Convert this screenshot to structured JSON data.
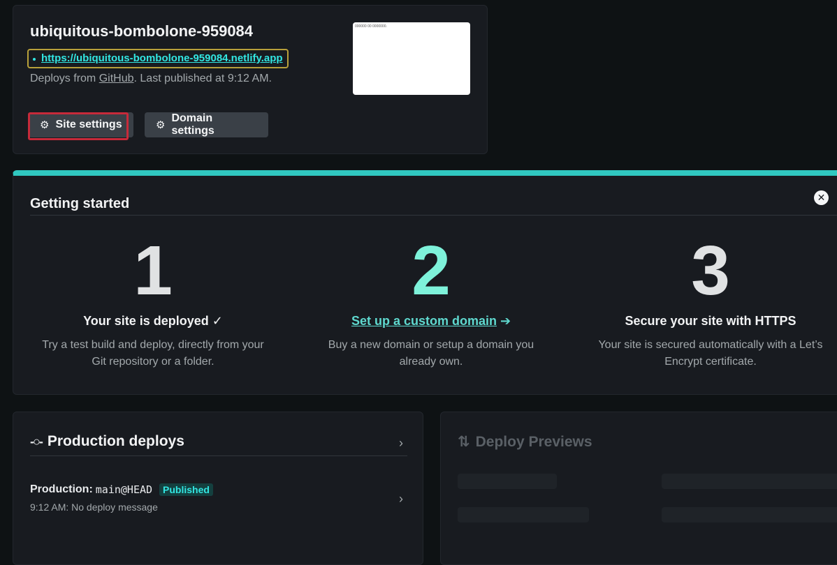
{
  "site": {
    "name": "ubiquitous-bombolone-959084",
    "url": "https://ubiquitous-bombolone-959084.netlify.app",
    "deploys_from_prefix": "Deploys from ",
    "deploys_from_provider": "GitHub",
    "last_published": ". Last published at 9:12 AM.",
    "thumb_text": "000000 00 0000000."
  },
  "buttons": {
    "site_settings": "Site settings",
    "domain_settings": "Domain settings",
    "gear_icon": "⚙"
  },
  "getting_started": {
    "title": "Getting started",
    "close_icon": "✕",
    "steps": [
      {
        "number": "1",
        "title": "Your site is deployed ✓",
        "description": "Try a test build and deploy, directly from your Git repository or a folder."
      },
      {
        "number": "2",
        "title_link": "Set up a custom domain",
        "title_arrow": " ➔",
        "description": "Buy a new domain or setup a domain you already own."
      },
      {
        "number": "3",
        "title": "Secure your site with HTTPS",
        "description": "Your site is secured automatically with a Let’s Encrypt certificate."
      }
    ]
  },
  "production": {
    "title": "Production deploys",
    "commit_icon": "-○-",
    "chevron": "›",
    "deploy": {
      "label": "Production:",
      "branch": "main@HEAD",
      "status": "Published",
      "time_message": "9:12 AM: No deploy message"
    }
  },
  "previews": {
    "title": "Deploy Previews",
    "icon": "⇅"
  },
  "colors": {
    "accent_teal": "#32e6e2",
    "step2_number": "#7ef2da",
    "highlight_red": "#c62a3a",
    "highlight_gold": "#b8a03a",
    "getting_started_top_border": "#30c8c0"
  }
}
